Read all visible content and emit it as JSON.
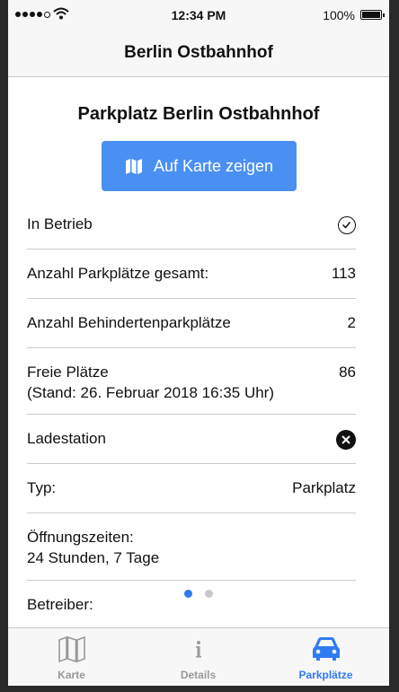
{
  "status": {
    "time": "12:34 PM",
    "battery": "100%"
  },
  "navbar": {
    "title": "Berlin Ostbahnhof"
  },
  "detail": {
    "title": "Parkplatz Berlin Ostbahnhof",
    "map_button_label": "Auf Karte zeigen",
    "rows": {
      "in_betrieb": {
        "label": "In Betrieb",
        "icon": "check-circle-icon"
      },
      "total": {
        "label": "Anzahl Parkplätze gesamt:",
        "value": "113"
      },
      "disabled": {
        "label": "Anzahl Behindertenparkplätze",
        "value": "2"
      },
      "free": {
        "label": "Freie Plätze",
        "value": "86",
        "stand": "(Stand: 26. Februar 2018 16:35 Uhr)"
      },
      "charging": {
        "label": "Ladestation",
        "icon": "x-circle-icon"
      },
      "type": {
        "label": "Typ:",
        "value": "Parkplatz"
      },
      "hours": {
        "label": "Öffnungszeiten:",
        "value": "24 Stunden, 7 Tage"
      },
      "operator": {
        "label": "Betreiber:"
      }
    },
    "page_indicator": {
      "pages": 2,
      "current": 1
    }
  },
  "tabbar": {
    "tabs": [
      {
        "label": "Karte",
        "icon": "map-icon",
        "active": false
      },
      {
        "label": "Details",
        "icon": "info-icon",
        "active": false
      },
      {
        "label": "Parkplätze",
        "icon": "car-icon",
        "active": true
      }
    ]
  },
  "colors": {
    "accent": "#2f7bf3",
    "button": "#4a90f2",
    "inactive": "#999999"
  }
}
